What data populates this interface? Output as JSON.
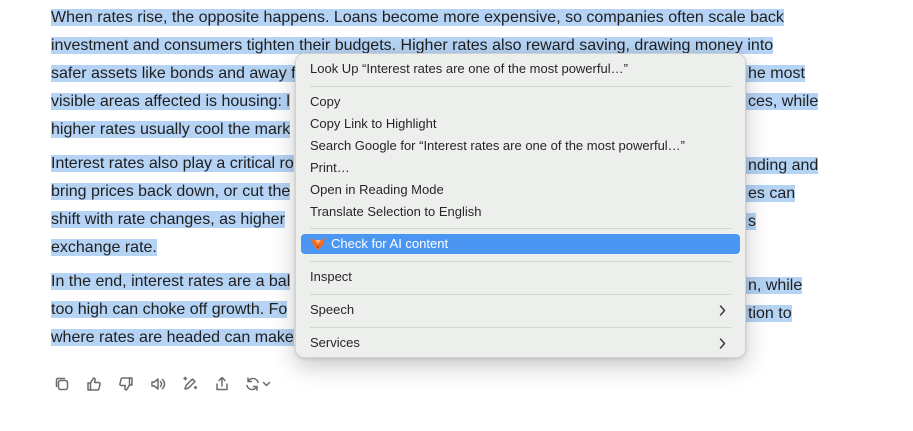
{
  "article": {
    "paragraphs": [
      {
        "lines": [
          "When rates rise, the opposite happens. Loans become more expensive, so companies often scale back",
          "investment and consumers tighten their budgets. Higher rates also reward saving, drawing money into",
          "safer assets like bonds and away f",
          "visible areas affected is housing: l",
          "higher rates usually cool the mark"
        ]
      },
      {
        "lines": [
          "Interest rates also play a critical ro",
          "bring prices back down, or cut the",
          "shift with rate changes, as higher",
          "exchange rate."
        ]
      },
      {
        "lines": [
          "In the end, interest rates are a bal",
          "too high can choke off growth. Fo",
          "where rates are headed can make"
        ]
      }
    ],
    "right_fragments": [
      "he most",
      "ces, while",
      "nding and",
      "es can",
      "s",
      "n, while",
      "tion to"
    ]
  },
  "context_menu": {
    "look_up": "Look Up “Interest rates are one of the most powerful…”",
    "copy": "Copy",
    "copy_link": "Copy Link to Highlight",
    "search_google": "Search Google for “Interest rates are one of the most powerful…”",
    "print": "Print…",
    "reading_mode": "Open in Reading Mode",
    "translate": "Translate Selection to English",
    "ai_check": "Check for AI content",
    "inspect": "Inspect",
    "speech": "Speech",
    "services": "Services"
  },
  "colors": {
    "selection_highlight": "#b5d3f4",
    "menu_active": "#4b96f3",
    "fox_orange": "#f26b21"
  },
  "toolbar_icons": [
    "copy-icon",
    "thumbs-up-icon",
    "thumbs-down-icon",
    "speaker-icon",
    "edit-sparkle-icon",
    "share-icon",
    "regenerate-icon"
  ]
}
